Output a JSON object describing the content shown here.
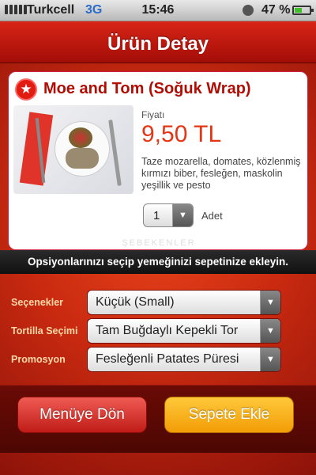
{
  "status_bar": {
    "carrier": "Turkcell",
    "network": "3G",
    "time": "15:46",
    "battery_percent_label": "47 %",
    "battery_level": 0.47
  },
  "nav": {
    "title": "Ürün Detay"
  },
  "product": {
    "name": "Moe and Tom (Soğuk Wrap)",
    "price_label": "Fiyatı",
    "price": "9,50 TL",
    "description": "Taze mozarella, domates, közlenmiş kırmızı biber, fesleğen, maskolin yeşillik ve pesto",
    "quantity": "1",
    "quantity_unit": "Adet",
    "watermark": "ŞEBEKENLER"
  },
  "info_text": "Opsiyonlarınızı seçip yemeğinizi sepetinize ekleyin.",
  "options": [
    {
      "label": "Seçenekler",
      "value": "Küçük (Small)"
    },
    {
      "label": "Tortilla Seçimi",
      "value": "Tam Buğdaylı Kepekli Tor"
    },
    {
      "label": "Promosyon",
      "value": "Fesleğenli Patates Püresi"
    }
  ],
  "buttons": {
    "back": "Menüye Dön",
    "add_to_cart": "Sepete Ekle"
  },
  "icons": {
    "favorite": "star-icon",
    "dropdown": "chevron-down-icon"
  },
  "colors": {
    "nav_red": "#c0170d",
    "price": "#e53613",
    "cart_button": "#f9b21c",
    "back_button": "#d9312b"
  }
}
